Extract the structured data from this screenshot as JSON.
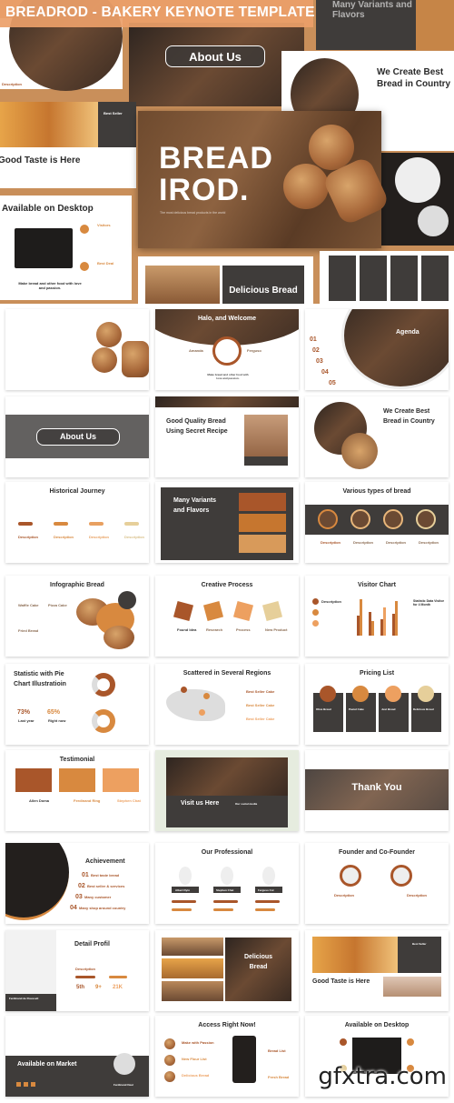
{
  "header": {
    "title": "BREADROD - BAKERY KEYNOTE TEMPLATE"
  },
  "hero": {
    "logo_line1": "BREAD",
    "logo_line2": "IROD.",
    "tagline": "The most delicious bread products in the world",
    "about": "About Us",
    "variants": "Many Variants and Flavors",
    "best": "We Create Best Bread in Country",
    "best_seller": "Best Seller",
    "good_taste": "Good Taste is Here",
    "desktop": "Available on Desktop",
    "desktop_quote": "Make bread and other food with love and passion.",
    "visitors": "Visitors",
    "best_deal": "Best Deal",
    "delicious": "Delicious Bread",
    "description": "Description"
  },
  "slides": {
    "cover": {
      "l1": "BREAD",
      "l2": "IROD."
    },
    "welcome": {
      "title": "Halo, and Welcome",
      "left": "Amanda",
      "right": "Ferguso",
      "quote": "Make bread and other food with love and passion."
    },
    "agenda": {
      "title": "Agenda",
      "items": [
        "01",
        "02",
        "03",
        "04",
        "05"
      ],
      "label": "Description"
    },
    "about": {
      "title": "About Us"
    },
    "quality": {
      "title1": "Good Quality Bread",
      "title2": "Using Secret Recipe"
    },
    "best": {
      "title1": "We Create Best",
      "title2": "Bread in Country"
    },
    "history": {
      "title": "Historical Journey",
      "label": "Description"
    },
    "variants": {
      "title1": "Many Variants",
      "title2": "and Flavors",
      "label": "Description"
    },
    "types": {
      "title": "Various types of bread",
      "label": "Description"
    },
    "infographic": {
      "title": "Infographic Bread",
      "labels": [
        "Waffle Cake",
        "Pizza Cake",
        "Fried Bread",
        "Best Seller"
      ]
    },
    "process": {
      "title": "Creative Process",
      "steps": [
        "Found Idea",
        "Research",
        "Process",
        "New Product"
      ]
    },
    "visitor": {
      "title": "Visitor Chart",
      "side": "Statistic Data Visitor for 4 Month",
      "label": "Description"
    },
    "pie": {
      "title1": "Statistic with Pie",
      "title2": "Chart Illustratioin",
      "v1": "73%",
      "v2": "65%",
      "l1": "Last year",
      "l2": "Right now"
    },
    "regions": {
      "title": "Scattered in Several Regions",
      "label": "Best Seller Cake"
    },
    "pricing": {
      "title": "Pricing List",
      "items": [
        "Olive Bread",
        "Pastel Cake",
        "Just Bread",
        "Delicious Bread"
      ]
    },
    "testimonial": {
      "title": "Testimonial",
      "people": [
        "Allen Doma",
        "Ferdinand Ring",
        "Stephen Chat"
      ]
    },
    "visit": {
      "title": "Visit us Here",
      "social": "Our social media"
    },
    "thanks": {
      "title": "Thank You"
    },
    "achievement": {
      "title": "Achievement",
      "items": [
        {
          "n": "01",
          "t": "Best taste bread"
        },
        {
          "n": "02",
          "t": "Best seller & services"
        },
        {
          "n": "03",
          "t": "Many customer"
        },
        {
          "n": "04",
          "t": "Many shop around country"
        }
      ]
    },
    "professional": {
      "title": "Our Professional",
      "names": [
        "Albert Dyin",
        "Stephen Chat",
        "Ferguso Col"
      ]
    },
    "founder": {
      "title": "Founder and Co-Founder",
      "label": "Description"
    },
    "profil": {
      "title": "Detail Profil",
      "name": "Ferdinand de Rousselt",
      "stats": [
        "5th",
        "9+",
        "21K"
      ],
      "label": "Description"
    },
    "delicious": {
      "title1": "Delicious",
      "title2": "Bread"
    },
    "goodtaste": {
      "title": "Good Taste is Here",
      "best": "Best Seller"
    },
    "market": {
      "title": "Available on Market",
      "name": "Ferdinand Deal"
    },
    "access": {
      "title": "Access Right Now!",
      "items": [
        "Make with Passion",
        "New Flour List",
        "Delicious Bread"
      ],
      "right": [
        "Bread List",
        "Fresh Bread"
      ]
    },
    "desktop": {
      "title": "Available on Desktop"
    }
  },
  "watermark": "gfxtra.com",
  "colors": {
    "brown": "#a9562a",
    "orange": "#d8893f",
    "light": "#e8b67a",
    "dark": "#3f3c3a",
    "hero_bg": "#c98f5a"
  }
}
